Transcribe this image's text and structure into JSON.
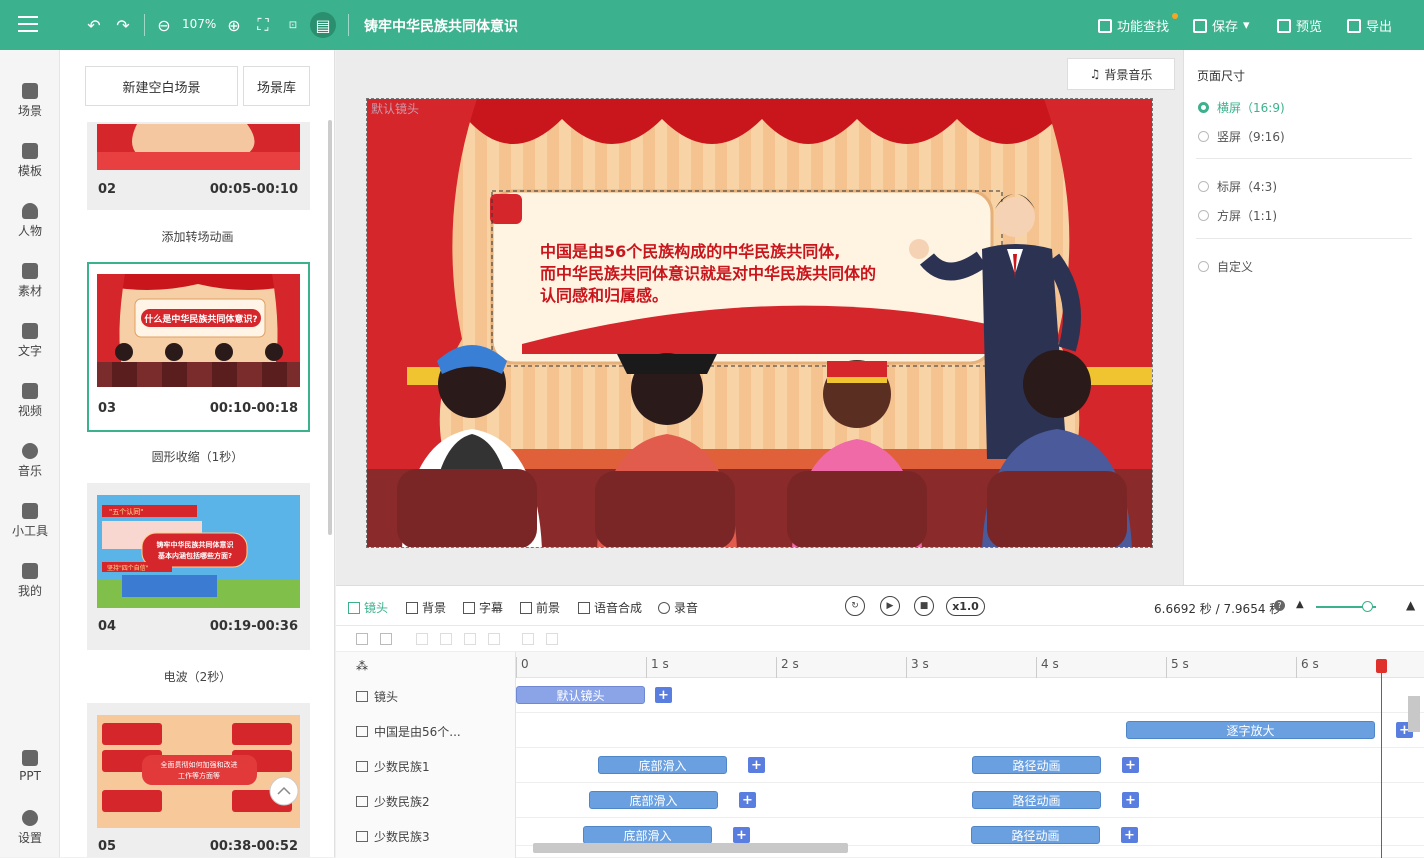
{
  "topbar": {
    "zoom": "107%",
    "title": "铸牢中华民族共同体意识",
    "actions": {
      "find": "功能查找",
      "save": "保存",
      "preview": "预览",
      "export": "导出"
    }
  },
  "nav": [
    "场景",
    "模板",
    "人物",
    "素材",
    "文字",
    "视频",
    "音乐",
    "小工具",
    "我的",
    "PPT",
    "设置"
  ],
  "scenes": {
    "new_blank": "新建空白场景",
    "library": "场景库",
    "items": [
      {
        "num": "02",
        "time": "00:05-00:10"
      },
      {
        "num": "03",
        "time": "00:10-00:18"
      },
      {
        "num": "04",
        "time": "00:19-00:36"
      },
      {
        "num": "05",
        "time": "00:38-00:52"
      }
    ],
    "transitions": [
      "添加转场动画",
      "圆形收缩（1秒）",
      "电波（2秒）"
    ],
    "thumb03_title": "什么是中华民族共同体意识?",
    "thumb04_title": "铸牢中华民族共同体意识\n基本内涵包括哪些方面?",
    "thumb04_tags": [
      "\"五个认同\"",
      "坚持\"四个自信\""
    ],
    "thumb05_title": "全面贯彻如何加强和改进\n工作等方面等"
  },
  "stage": {
    "music_button": "背景音乐",
    "camera_label": "默认镜头",
    "board_text": [
      "中国是由56个民族构成的中华民族共同体,",
      "而中华民族共同体意识就是对中华民族共同体的",
      "认同感和归属感。"
    ]
  },
  "props": {
    "title": "页面尺寸",
    "options": [
      {
        "label": "横屏（16:9)",
        "selected": true
      },
      {
        "label": "竖屏（9:16)",
        "selected": false
      },
      {
        "label": "标屏（4:3)",
        "selected": false
      },
      {
        "label": "方屏（1:1)",
        "selected": false
      },
      {
        "label": "自定义",
        "selected": false
      }
    ]
  },
  "timeline": {
    "tabs": [
      "镜头",
      "背景",
      "字幕",
      "前景",
      "语音合成",
      "录音"
    ],
    "speed": "x1.0",
    "time": "6.6692 秒 / 7.9654 秒",
    "ruler": [
      "0",
      "1 s",
      "2 s",
      "3 s",
      "4 s",
      "5 s",
      "6 s"
    ],
    "rows": [
      {
        "name": "镜头",
        "clips": [
          "默认镜头"
        ]
      },
      {
        "name": "中国是由56个...",
        "clips": [
          "逐字放大"
        ]
      },
      {
        "name": "少数民族1",
        "clips": [
          "底部滑入",
          "路径动画"
        ]
      },
      {
        "name": "少数民族2",
        "clips": [
          "底部滑入",
          "路径动画"
        ]
      },
      {
        "name": "少数民族3",
        "clips": [
          "底部滑入",
          "路径动画"
        ]
      }
    ],
    "playhead_seconds": 6.6692,
    "duration_seconds": 7.9654
  },
  "colors": {
    "brand": "#3cb18d",
    "clip": "#6aa0e0",
    "camera_clip": "#8ba4e8",
    "playhead": "#e0302b"
  }
}
